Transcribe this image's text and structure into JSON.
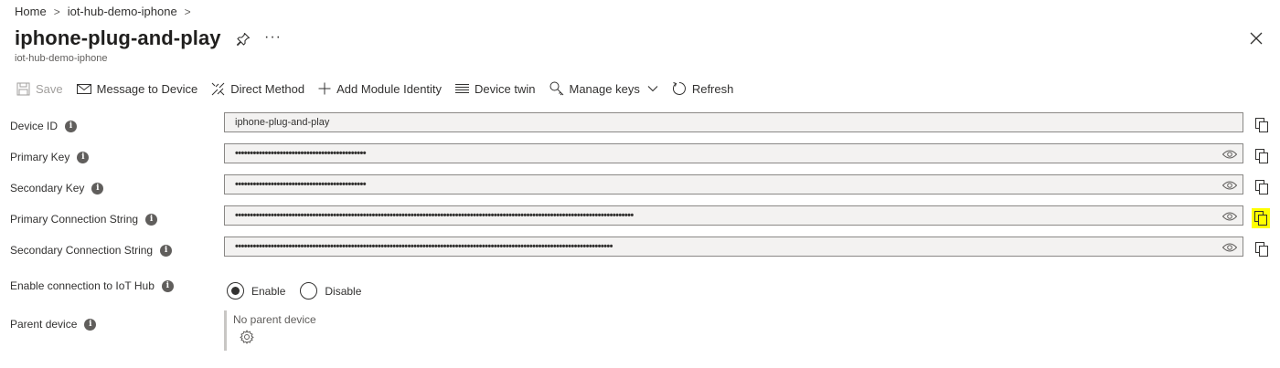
{
  "breadcrumb": {
    "items": [
      "Home",
      "iot-hub-demo-iphone"
    ],
    "separator": ">"
  },
  "header": {
    "title": "iphone-plug-and-play",
    "subtitle": "iot-hub-demo-iphone",
    "more_label": "···"
  },
  "toolbar": {
    "save": "Save",
    "message": "Message to Device",
    "direct_method": "Direct Method",
    "add_module": "Add Module Identity",
    "device_twin": "Device twin",
    "manage_keys": "Manage keys",
    "refresh": "Refresh"
  },
  "fields": {
    "device_id": {
      "label": "Device ID",
      "value": "iphone-plug-and-play"
    },
    "primary_key": {
      "label": "Primary Key",
      "value": "••••••••••••••••••••••••••••••••••••••••••••"
    },
    "secondary_key": {
      "label": "Secondary Key",
      "value": "••••••••••••••••••••••••••••••••••••••••••••"
    },
    "primary_conn": {
      "label": "Primary Connection String",
      "value": "••••••••••••••••••••••••••••••••••••••••••••••••••••••••••••••••••••••••••••••••••••••••••••••••••••••••••••••••••••••••••••••••••••••"
    },
    "secondary_conn": {
      "label": "Secondary Connection String",
      "value": "•••••••••••••••••••••••••••••••••••••••••••••••••••••••••••••••••••••••••••••••••••••••••••••••••••••••••••••••••••••••••••••••"
    }
  },
  "connection": {
    "label": "Enable connection to IoT Hub",
    "enable": "Enable",
    "disable": "Disable",
    "selected": "Enable"
  },
  "parent": {
    "label": "Parent device",
    "value": "No parent device"
  },
  "colors": {
    "highlight": "#ffff00",
    "field_bg": "#f3f2f1",
    "text": "#323130"
  }
}
